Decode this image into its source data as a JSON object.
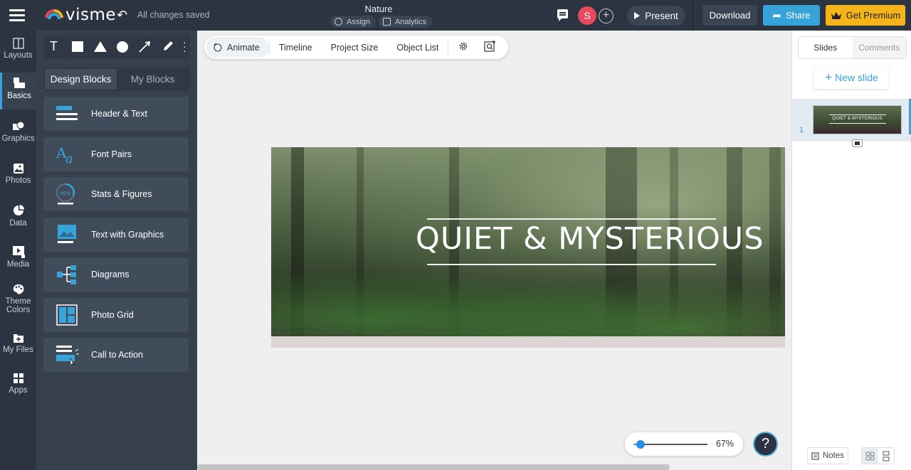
{
  "header": {
    "save_status": "All changes saved",
    "doc_title": "Nature",
    "assign_label": "Assign",
    "analytics_label": "Analytics",
    "avatar_initial": "S",
    "present_label": "Present",
    "download_label": "Download",
    "share_label": "Share",
    "premium_label": "Get Premium",
    "brand": "visme"
  },
  "rail": {
    "items": [
      {
        "label": "Layouts",
        "icon": "layouts-icon"
      },
      {
        "label": "Basics",
        "icon": "basics-icon"
      },
      {
        "label": "Graphics",
        "icon": "graphics-icon"
      },
      {
        "label": "Photos",
        "icon": "photos-icon"
      },
      {
        "label": "Data",
        "icon": "data-icon"
      },
      {
        "label": "Media",
        "icon": "media-icon"
      },
      {
        "label": "Theme",
        "label2": "Colors",
        "icon": "palette-icon"
      },
      {
        "label": "My Files",
        "icon": "files-icon"
      },
      {
        "label": "Apps",
        "icon": "apps-icon"
      }
    ]
  },
  "panel": {
    "tabs": [
      "Design Blocks",
      "My Blocks"
    ],
    "blocks": [
      {
        "label": "Header & Text"
      },
      {
        "label": "Font Pairs"
      },
      {
        "label": "Stats & Figures",
        "badge": "40%"
      },
      {
        "label": "Text with Graphics"
      },
      {
        "label": "Diagrams"
      },
      {
        "label": "Photo Grid"
      },
      {
        "label": "Call to Action"
      }
    ]
  },
  "canvas_toolbar": {
    "animate": "Animate",
    "timeline": "Timeline",
    "project_size": "Project Size",
    "object_list": "Object List"
  },
  "slide": {
    "title": "QUIET & MYSTERIOUS"
  },
  "zoom": {
    "value_label": "67%",
    "level": 0.1
  },
  "right_panel": {
    "tabs": [
      "Slides",
      "Comments"
    ],
    "new_slide": "New slide",
    "slide_number": "1",
    "thumb_title": "QUIET & MYSTERIOUS",
    "notes_label": "Notes"
  },
  "help_label": "?",
  "colors": {
    "accent": "#36a3d9",
    "dark": "#2b3440",
    "premium": "#f6b41b",
    "avatar": "#e8495e"
  }
}
